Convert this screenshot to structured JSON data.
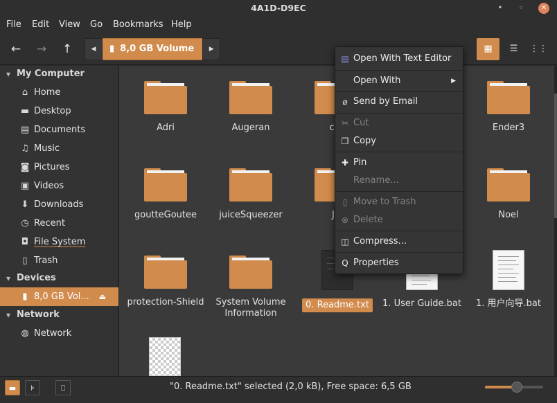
{
  "window": {
    "title": "4A1D-D9EC"
  },
  "menubar": [
    "File",
    "Edit",
    "View",
    "Go",
    "Bookmarks",
    "Help"
  ],
  "toolbar": {
    "back_icon": "back-arrow-icon",
    "forward_icon": "forward-arrow-icon",
    "up_icon": "up-arrow-icon",
    "breadcrumb": "8,0 GB Volume"
  },
  "sidebar": {
    "sections": [
      {
        "title": "My Computer",
        "items": [
          "Home",
          "Desktop",
          "Documents",
          "Music",
          "Pictures",
          "Videos",
          "Downloads",
          "Recent",
          "File System",
          "Trash"
        ]
      },
      {
        "title": "Devices",
        "items": [
          "8,0 GB Vol..."
        ]
      },
      {
        "title": "Network",
        "items": [
          "Network"
        ]
      }
    ]
  },
  "files": [
    {
      "name": "Adri",
      "type": "folder"
    },
    {
      "name": "Augeran",
      "type": "folder"
    },
    {
      "name": "cal",
      "type": "folder"
    },
    {
      "name": "Ender3",
      "type": "folder"
    },
    {
      "name": "goutteGoutee",
      "type": "folder"
    },
    {
      "name": "juiceSqueezer",
      "type": "folder"
    },
    {
      "name": "Ju",
      "type": "folder"
    },
    {
      "name": "Noel",
      "type": "folder"
    },
    {
      "name": "protection-Shield",
      "type": "folder"
    },
    {
      "name": "System Volume Information",
      "type": "folder"
    },
    {
      "name": "0. Readme.txt",
      "type": "text",
      "selected": true
    },
    {
      "name": "1. User Guide.bat",
      "type": "document"
    },
    {
      "name": "1. 用户向导.bat",
      "type": "document"
    },
    {
      "name": "",
      "type": "image"
    }
  ],
  "context_menu": {
    "items": [
      {
        "label": "Open With Text Editor",
        "icon": "text-editor-icon",
        "enabled": true
      },
      {
        "label": "Open With",
        "icon": "",
        "enabled": true,
        "submenu": true
      },
      {
        "label": "Send by Email",
        "icon": "paperclip-icon",
        "enabled": true
      },
      {
        "label": "Cut",
        "icon": "scissors-icon",
        "enabled": false
      },
      {
        "label": "Copy",
        "icon": "copy-icon",
        "enabled": true
      },
      {
        "label": "Pin",
        "icon": "pin-icon",
        "enabled": true
      },
      {
        "label": "Rename...",
        "icon": "",
        "enabled": false
      },
      {
        "label": "Move to Trash",
        "icon": "trash-icon",
        "enabled": false
      },
      {
        "label": "Delete",
        "icon": "delete-icon",
        "enabled": false
      },
      {
        "label": "Compress...",
        "icon": "archive-icon",
        "enabled": true
      },
      {
        "label": "Properties",
        "icon": "properties-icon",
        "enabled": true
      }
    ]
  },
  "statusbar": {
    "text": "\"0. Readme.txt\" selected (2,0 kB), Free space: 6,5 GB",
    "zoom_fraction": 0.55
  },
  "colors": {
    "accent": "#d18b4c",
    "background": "#3a3a3a",
    "sidebar": "#333333"
  }
}
